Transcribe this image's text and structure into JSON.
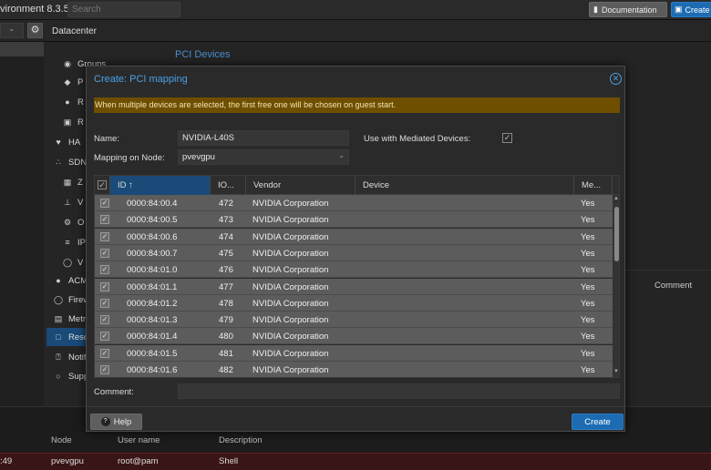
{
  "app": {
    "title": "vironment 8.3.5",
    "search_placeholder": "Search",
    "documentation_label": "Documentation",
    "create_label": "Create",
    "breadcrumb": "Datacenter"
  },
  "nav": {
    "items": [
      {
        "label": "Groups",
        "icon": "groups-icon"
      },
      {
        "label": "P",
        "icon": "tag-icon"
      },
      {
        "label": "R",
        "icon": "user-icon"
      },
      {
        "label": "R",
        "icon": "id-card-icon"
      },
      {
        "label": "HA",
        "icon": "heartbeat-icon"
      },
      {
        "label": "SDN",
        "icon": "network-icon"
      },
      {
        "label": "Z",
        "icon": "grid-icon"
      },
      {
        "label": "V",
        "icon": "sitemap-icon"
      },
      {
        "label": "O",
        "icon": "gear-icon"
      },
      {
        "label": "IP",
        "icon": "signpost-icon"
      },
      {
        "label": "V",
        "icon": "shield-icon"
      },
      {
        "label": "ACM",
        "icon": "certificate-icon"
      },
      {
        "label": "Firew",
        "icon": "shield-icon"
      },
      {
        "label": "Metri",
        "icon": "bar-chart-icon"
      },
      {
        "label": "Reso",
        "icon": "folder-icon"
      },
      {
        "label": "Notifi",
        "icon": "bell-icon"
      },
      {
        "label": "Supp",
        "icon": "comments-icon"
      }
    ]
  },
  "main": {
    "heading": "PCI Devices",
    "comment_header": "Comment"
  },
  "log": {
    "headers": {
      "node": "Node",
      "user": "User name",
      "desc": "Description"
    },
    "row": {
      "time": ":49",
      "node": "pvevgpu",
      "user": "root@pam",
      "desc": "Shell"
    }
  },
  "modal": {
    "title": "Create: PCI mapping",
    "warning": "When multiple devices are selected, the first free one will be chosen on guest start.",
    "name_label": "Name:",
    "name_value": "NVIDIA-L40S",
    "node_label": "Mapping on Node:",
    "node_value": "pvevgpu",
    "mdev_label": "Use with Mediated Devices:",
    "mdev_checked": true,
    "comment_label": "Comment:",
    "comment_value": "",
    "help_label": "Help",
    "create_label": "Create",
    "grid": {
      "headers": {
        "id": "ID",
        "iommu": "IO...",
        "vendor": "Vendor",
        "device": "Device",
        "mdev": "Me..."
      },
      "rows": [
        {
          "id": "0000:84:00.4",
          "iommu": "472",
          "vendor": "NVIDIA Corporation",
          "device": "",
          "mdev": "Yes"
        },
        {
          "id": "0000:84:00.5",
          "iommu": "473",
          "vendor": "NVIDIA Corporation",
          "device": "",
          "mdev": "Yes"
        },
        {
          "id": "0000:84:00.6",
          "iommu": "474",
          "vendor": "NVIDIA Corporation",
          "device": "",
          "mdev": "Yes"
        },
        {
          "id": "0000:84:00.7",
          "iommu": "475",
          "vendor": "NVIDIA Corporation",
          "device": "",
          "mdev": "Yes"
        },
        {
          "id": "0000:84:01.0",
          "iommu": "476",
          "vendor": "NVIDIA Corporation",
          "device": "",
          "mdev": "Yes"
        },
        {
          "id": "0000:84:01.1",
          "iommu": "477",
          "vendor": "NVIDIA Corporation",
          "device": "",
          "mdev": "Yes"
        },
        {
          "id": "0000:84:01.2",
          "iommu": "478",
          "vendor": "NVIDIA Corporation",
          "device": "",
          "mdev": "Yes"
        },
        {
          "id": "0000:84:01.3",
          "iommu": "479",
          "vendor": "NVIDIA Corporation",
          "device": "",
          "mdev": "Yes"
        },
        {
          "id": "0000:84:01.4",
          "iommu": "480",
          "vendor": "NVIDIA Corporation",
          "device": "",
          "mdev": "Yes"
        },
        {
          "id": "0000:84:01.5",
          "iommu": "481",
          "vendor": "NVIDIA Corporation",
          "device": "",
          "mdev": "Yes"
        },
        {
          "id": "0000:84:01.6",
          "iommu": "482",
          "vendor": "NVIDIA Corporation",
          "device": "",
          "mdev": "Yes"
        }
      ]
    }
  },
  "colors": {
    "accent": "#1c6bb3",
    "warning_bg": "#6e4f00",
    "link": "#4aa0e6"
  }
}
